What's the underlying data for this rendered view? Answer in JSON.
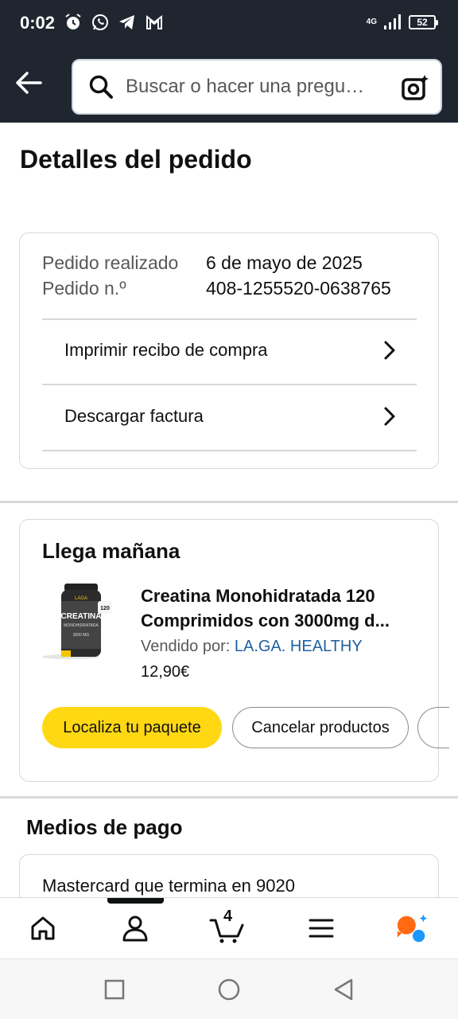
{
  "status_bar": {
    "time": "0:02",
    "network": "4G",
    "battery": "52"
  },
  "header": {
    "search_placeholder": "Buscar o hacer una pregu…"
  },
  "page_title": "Detalles del pedido",
  "order": {
    "placed_label": "Pedido realizado",
    "placed_value": "6 de mayo de 2025",
    "number_label": "Pedido n.º",
    "number_value": "408-1255520-0638765",
    "links": [
      {
        "label": "Imprimir recibo de compra"
      },
      {
        "label": "Descargar factura"
      }
    ]
  },
  "shipment": {
    "title": "Llega mañana",
    "product_title_line1": "Creatina Monohidratada 120",
    "product_title_line2": "Comprimidos con 3000mg d...",
    "sold_by_label": "Vendido por: ",
    "seller": "LA.GA. HEALTHY",
    "price": "12,90€",
    "primary_button": "Localiza tu paquete",
    "secondary_button": "Cancelar productos",
    "product_image_text": {
      "brand": "LAGA",
      "name_line1": "CREATINA",
      "name_line2": "MONOHIDRATADA",
      "dose": "3000 MG",
      "count": "120"
    }
  },
  "payment": {
    "title": "Medios de pago",
    "method": "Mastercard  que termina en 9020"
  },
  "bottom_nav": {
    "cart_count": "4",
    "items": [
      "home-icon",
      "account-icon",
      "cart-icon",
      "menu-icon",
      "rufus-icon"
    ]
  },
  "colors": {
    "header_bg": "#1f2630",
    "primary_button": "#ffd814",
    "link": "#2162a1",
    "rufus_orange": "#ff6a13",
    "rufus_blue": "#1a98ff"
  }
}
